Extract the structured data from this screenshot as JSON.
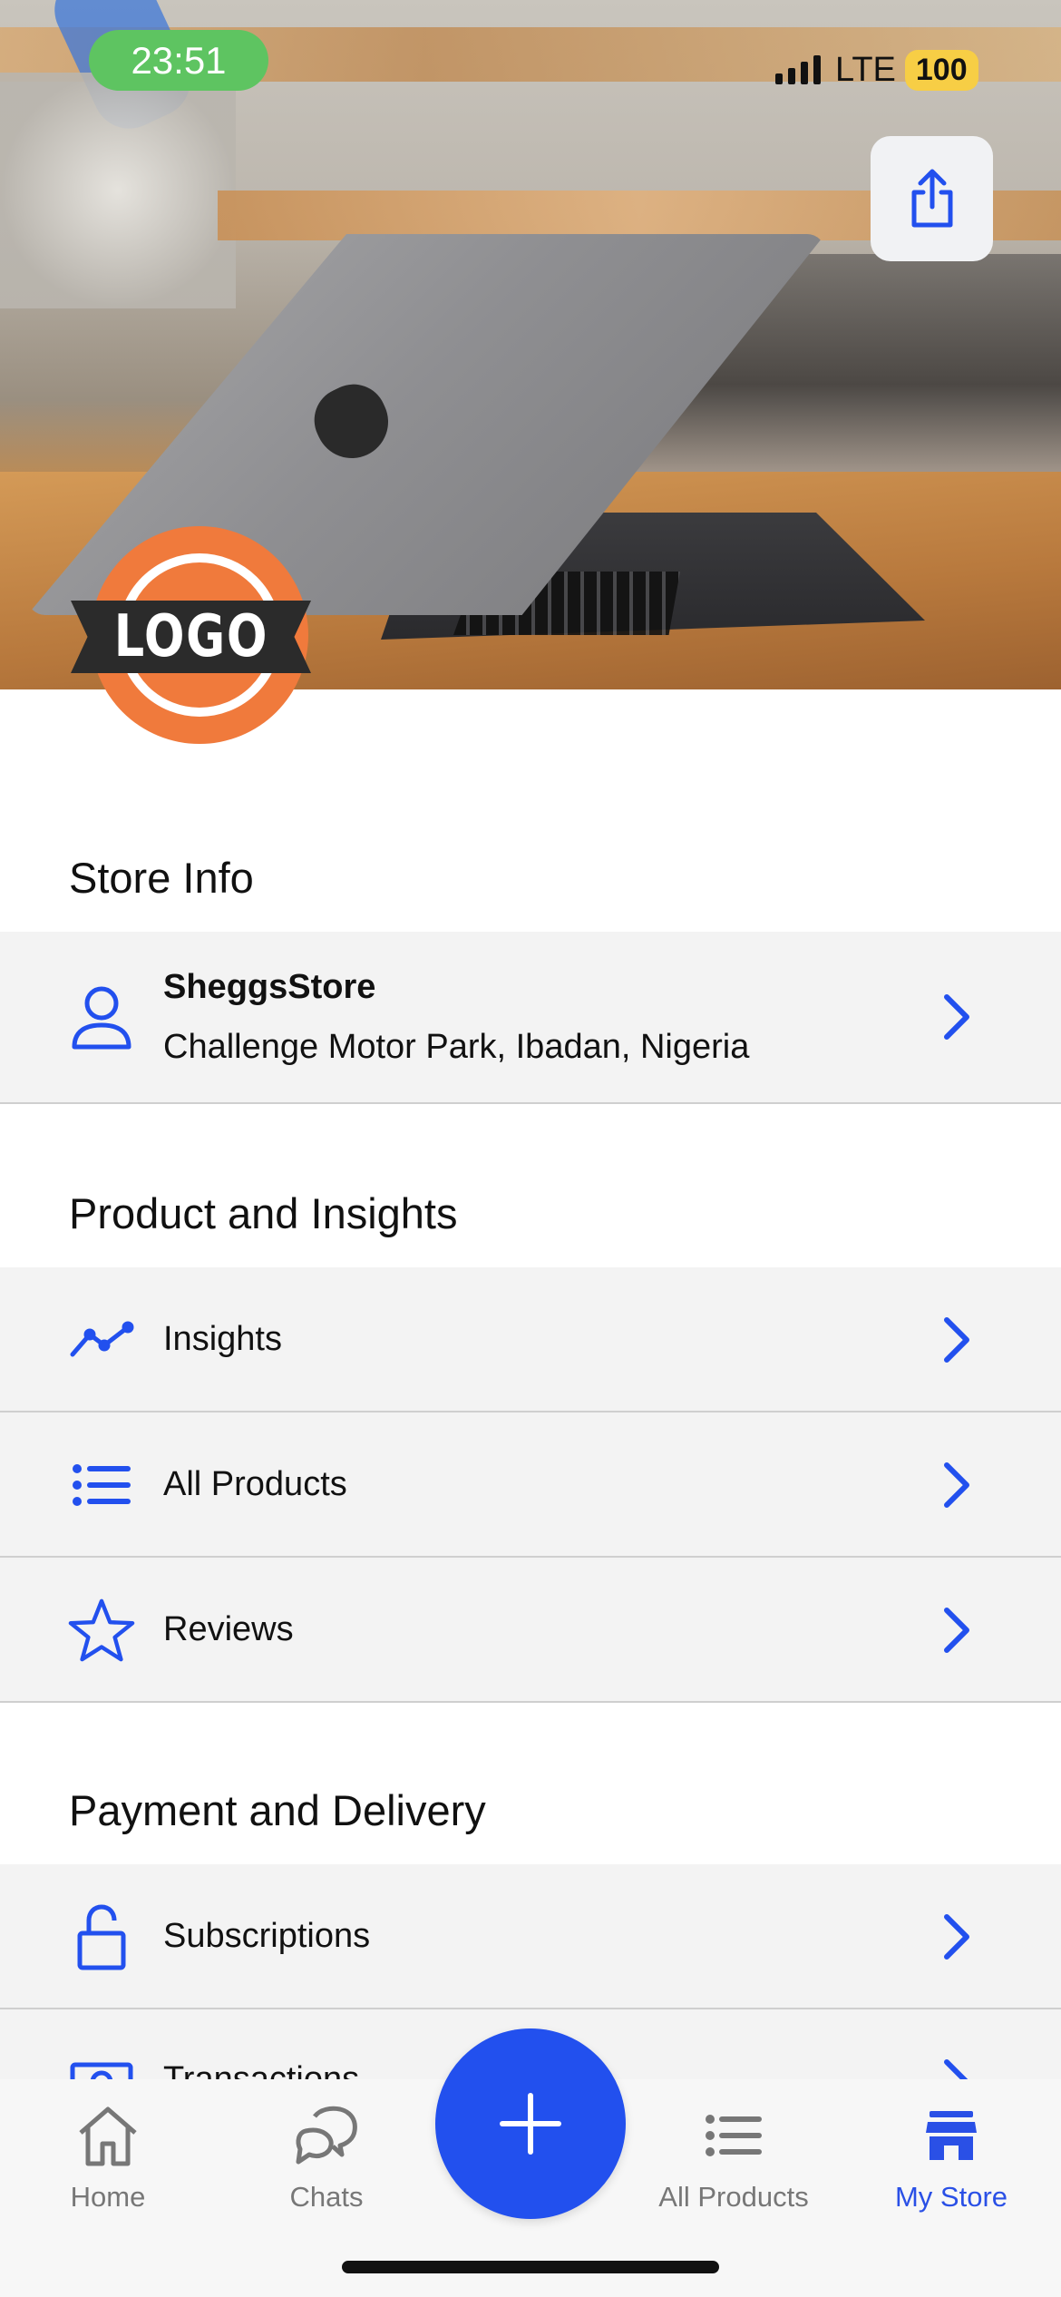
{
  "status_bar": {
    "time": "23:51",
    "network": "LTE",
    "battery": "100"
  },
  "hero": {
    "logo_text": "LOGO"
  },
  "colors": {
    "accent": "#2250ee",
    "status_time_bg": "#5ec461",
    "battery_bg": "#f7ce45",
    "logo_orange": "#f07a3c"
  },
  "sections": {
    "store_info": {
      "title": "Store Info",
      "store_name": "SheggsStore",
      "store_address": "Challenge Motor Park, Ibadan, Nigeria"
    },
    "product_insights": {
      "title": "Product and Insights",
      "items": [
        {
          "label": "Insights",
          "icon": "trend-line-icon"
        },
        {
          "label": "All Products",
          "icon": "list-icon"
        },
        {
          "label": "Reviews",
          "icon": "star-icon"
        }
      ]
    },
    "payment_delivery": {
      "title": "Payment and Delivery",
      "items": [
        {
          "label": "Subscriptions",
          "icon": "unlock-icon"
        },
        {
          "label": "Transactions",
          "icon": "money-icon"
        }
      ]
    }
  },
  "tabbar": {
    "items": [
      {
        "label": "Home",
        "icon": "home-icon",
        "active": false
      },
      {
        "label": "Chats",
        "icon": "chat-icon",
        "active": false
      },
      {
        "label": "All Products",
        "icon": "list-icon",
        "active": false
      },
      {
        "label": "My Store",
        "icon": "store-icon",
        "active": true
      }
    ],
    "fab": "plus-icon"
  }
}
